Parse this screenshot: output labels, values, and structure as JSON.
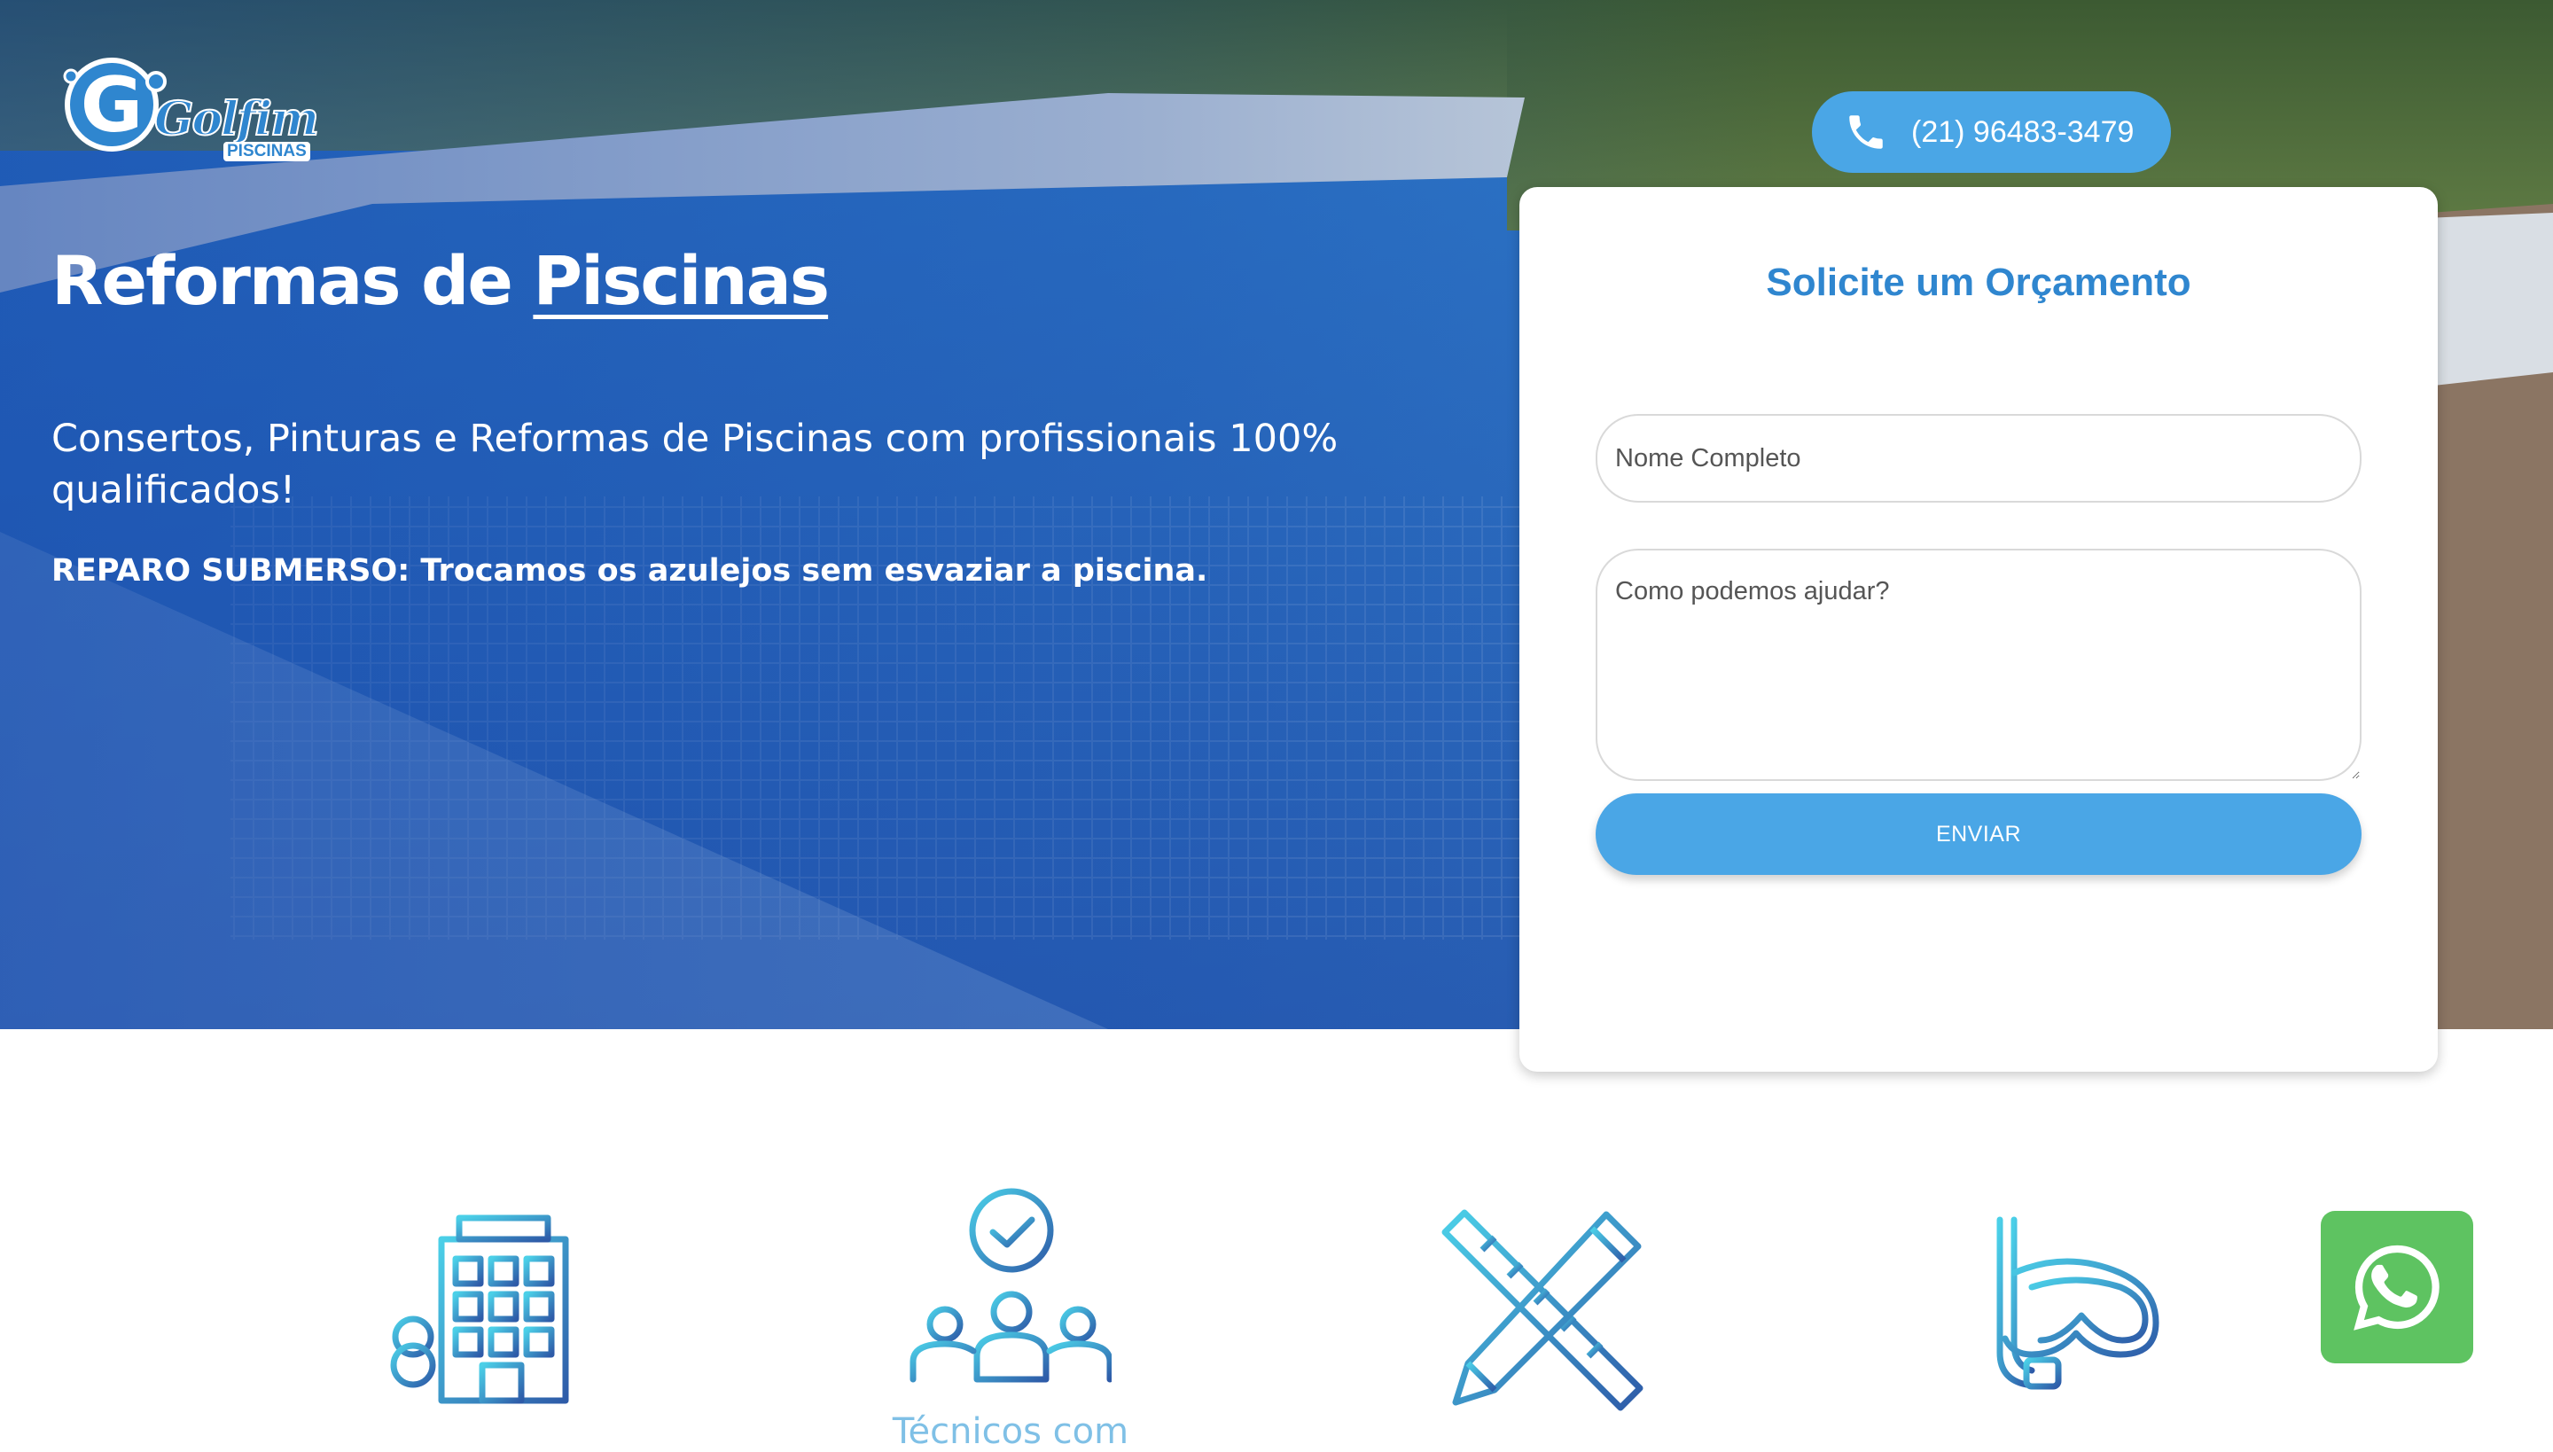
{
  "header": {
    "logo_text": "Golfim",
    "logo_sub": "PISCINAS",
    "phone": "(21) 96483-3479"
  },
  "hero": {
    "title_plain": "Reformas de ",
    "title_underlined": "Piscinas",
    "subtitle": "Consertos, Pinturas e Reformas de Piscinas com profissionais 100% qualificados!",
    "note": "REPARO SUBMERSO: Trocamos os azulejos sem esvaziar a piscina."
  },
  "form": {
    "title": "Solicite um Orçamento",
    "name_placeholder": "Nome Completo",
    "message_placeholder": "Como podemos ajudar?",
    "submit_label": "ENVIAR"
  },
  "features": {
    "icons": [
      "building-icon",
      "team-check-icon",
      "ruler-pencil-icon",
      "snorkel-mask-icon"
    ],
    "visible_label": "Técnicos com"
  },
  "colors": {
    "accent": "#4aa6e6",
    "form_title": "#2f86cf",
    "whatsapp": "#5ec361",
    "feature_label": "#7fc0e6"
  }
}
